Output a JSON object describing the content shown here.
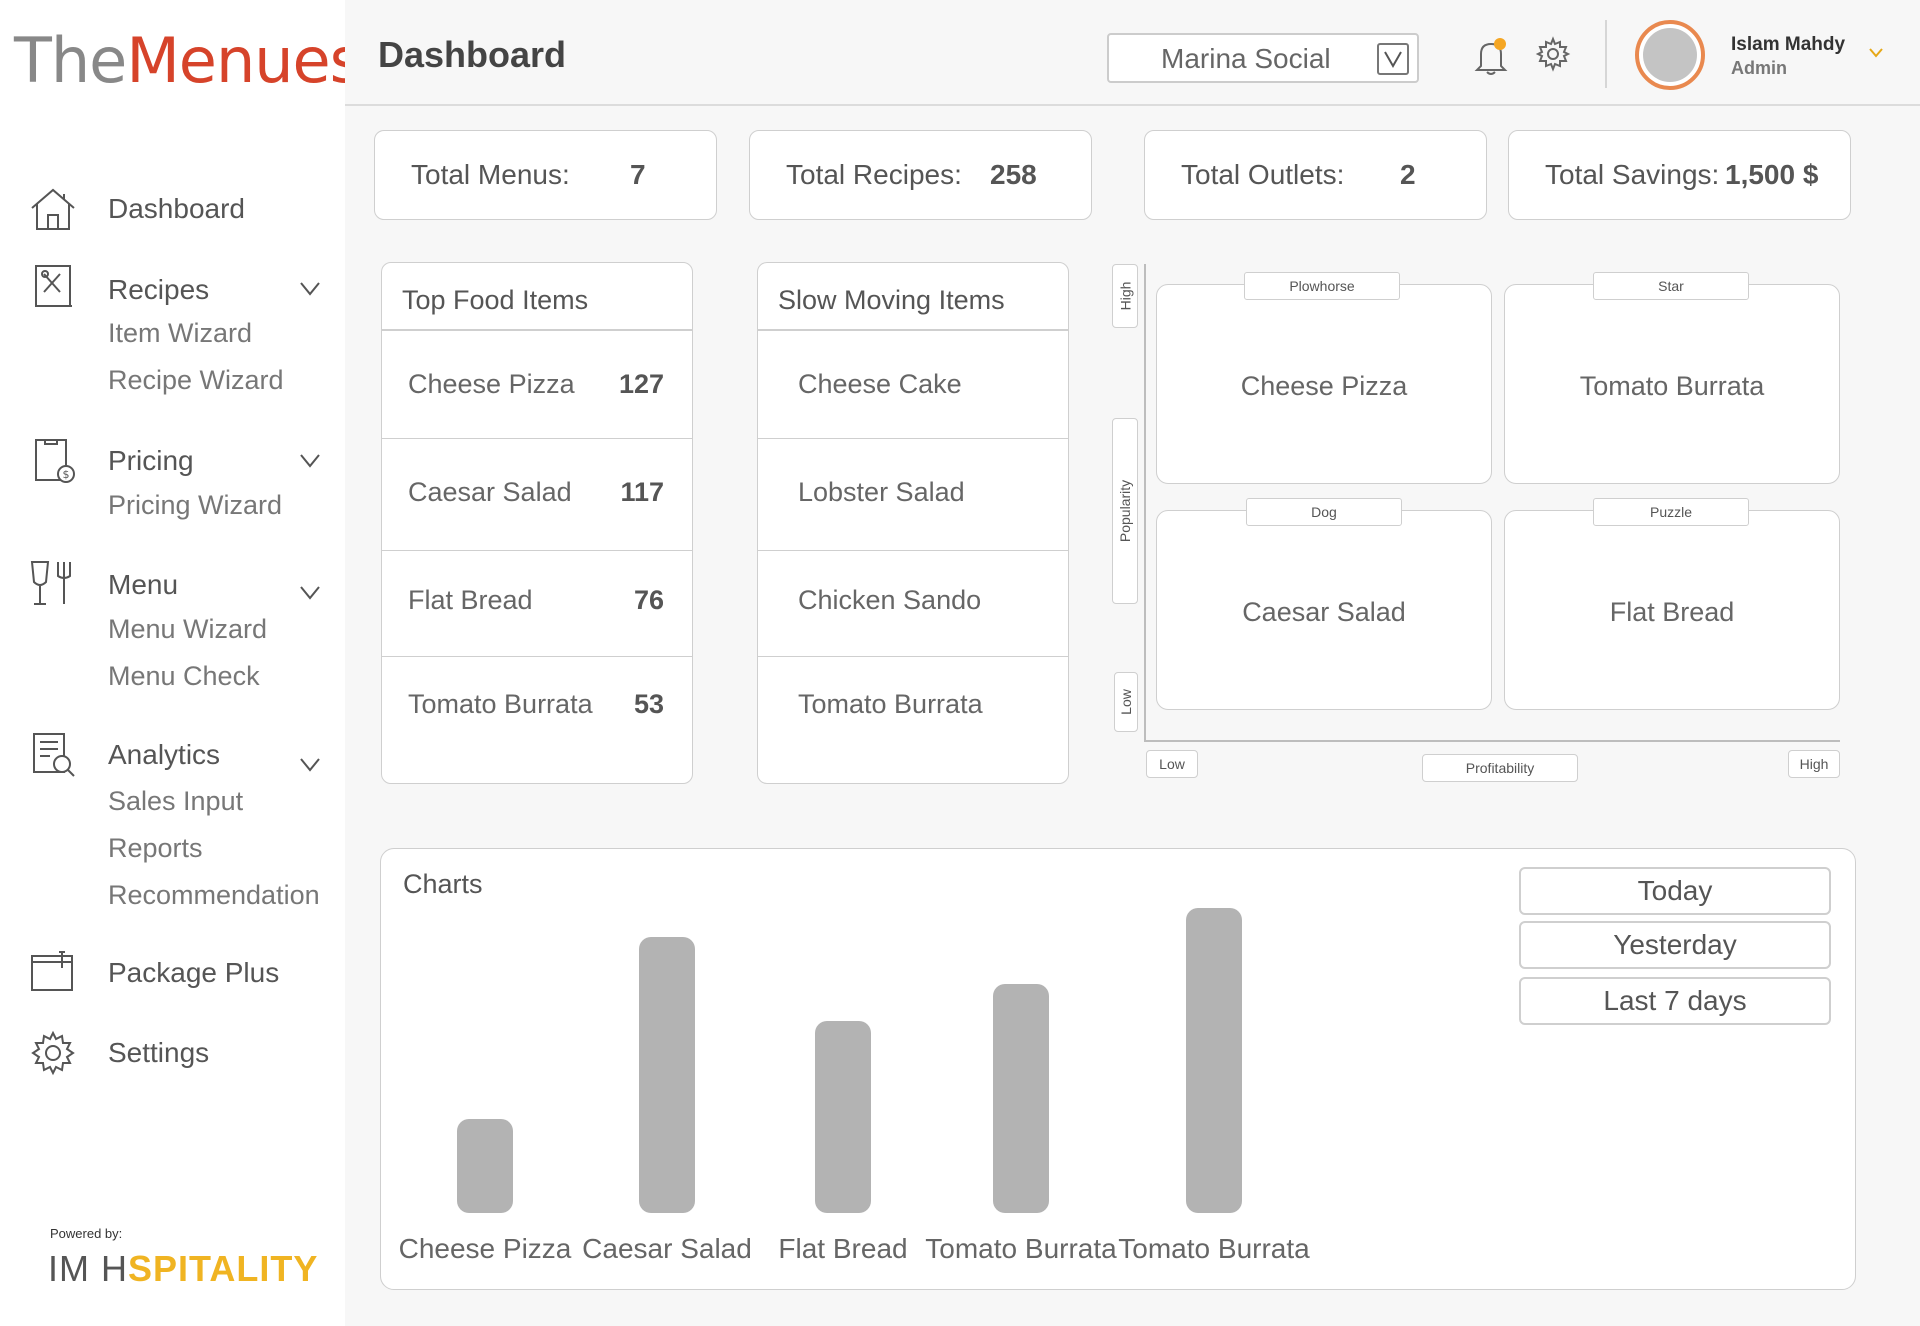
{
  "app": {
    "logo_part1": "The",
    "logo_part2": "Menues",
    "powered_by": "Powered by:",
    "partner_logo_part1": "IM H",
    "partner_logo_part2": "SPITALITY",
    "accent_color": "#d6432a"
  },
  "sidebar": {
    "dashboard": "Dashboard",
    "recipes": {
      "label": "Recipes",
      "items": [
        "Item Wizard",
        "Recipe Wizard"
      ]
    },
    "pricing": {
      "label": "Pricing",
      "items": [
        "Pricing Wizard"
      ]
    },
    "menu": {
      "label": "Menu",
      "items": [
        "Menu Wizard",
        "Menu Check"
      ]
    },
    "analytics": {
      "label": "Analytics",
      "items": [
        "Sales Input",
        "Reports",
        "Recommendation"
      ]
    },
    "package_plus": "Package Plus",
    "settings": "Settings"
  },
  "header": {
    "title": "Dashboard",
    "outlet_selected": "Marina Social",
    "user_name": "Islam Mahdy",
    "user_role": "Admin",
    "notification_dot_color": "#f5a623",
    "avatar_ring_color": "#e9894f"
  },
  "stats": [
    {
      "label": "Total Menus:",
      "value": "7"
    },
    {
      "label": "Total Recipes:",
      "value": "258"
    },
    {
      "label": "Total Outlets:",
      "value": "2"
    },
    {
      "label": "Total Savings:",
      "value": "1,500 $"
    }
  ],
  "top_food": {
    "title": "Top Food Items",
    "rows": [
      {
        "name": "Cheese Pizza",
        "count": "127"
      },
      {
        "name": "Caesar Salad",
        "count": "117"
      },
      {
        "name": "Flat Bread",
        "count": "76"
      },
      {
        "name": "Tomato Burrata",
        "count": "53"
      }
    ]
  },
  "slow_moving": {
    "title": "Slow Moving Items",
    "rows": [
      "Cheese Cake",
      "Lobster Salad",
      "Chicken Sando",
      "Tomato Burrata"
    ]
  },
  "matrix": {
    "y_axis": {
      "high": "High",
      "label": "Popularity",
      "low": "Low"
    },
    "x_axis": {
      "low": "Low",
      "label": "Profitability",
      "high": "High"
    },
    "quadrants": [
      {
        "tag": "Plowhorse",
        "item": "Cheese Pizza"
      },
      {
        "tag": "Star",
        "item": "Tomato Burrata"
      },
      {
        "tag": "Dog",
        "item": "Caesar Salad"
      },
      {
        "tag": "Puzzle",
        "item": "Flat Bread"
      }
    ]
  },
  "charts": {
    "title": "Charts",
    "ranges": [
      "Today",
      "Yesterday",
      "Last 7 days"
    ],
    "bar_color": "#b3b3b3"
  },
  "chart_data": {
    "type": "bar",
    "categories": [
      "Cheese Pizza",
      "Caesar Salad",
      "Flat Bread",
      "Tomato Burrata",
      "Tomato Burrata"
    ],
    "values": [
      30,
      88,
      61,
      73,
      97
    ],
    "title": "",
    "xlabel": "",
    "ylabel": "",
    "ylim": [
      0,
      100
    ],
    "grid": false
  }
}
